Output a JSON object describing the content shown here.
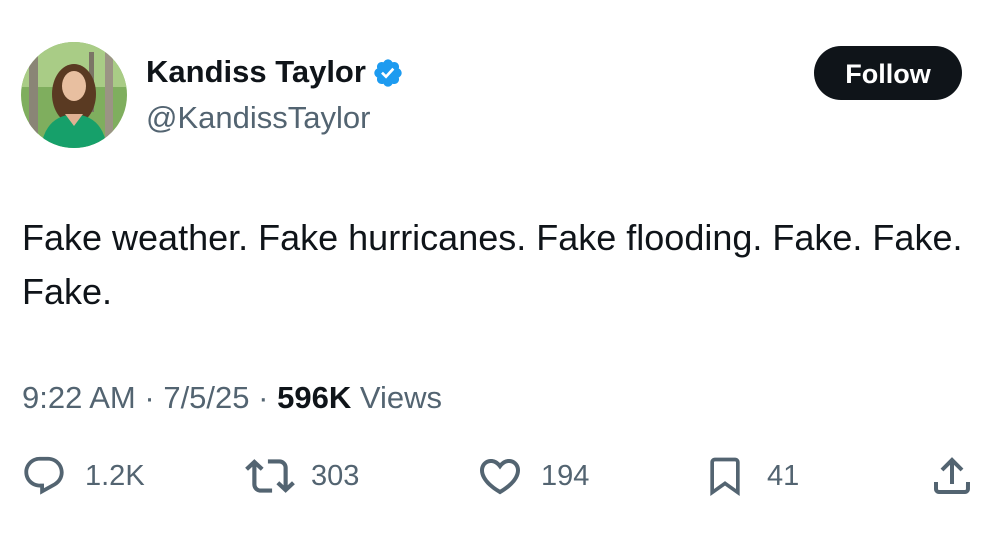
{
  "profile": {
    "display_name": "Kandiss Taylor",
    "handle": "@KandissTaylor",
    "verified": true
  },
  "follow_button": {
    "label": "Follow"
  },
  "tweet": {
    "text": "Fake weather. Fake hurricanes. Fake flooding. Fake. Fake. Fake."
  },
  "meta": {
    "time": "9:22 AM",
    "separator": "·",
    "date": "7/5/25",
    "views_count": "596K",
    "views_label": "Views"
  },
  "actions": {
    "replies": {
      "icon": "reply-icon",
      "count": "1.2K"
    },
    "reposts": {
      "icon": "repost-icon",
      "count": "303"
    },
    "likes": {
      "icon": "heart-icon",
      "count": "194"
    },
    "bookmarks": {
      "icon": "bookmark-icon",
      "count": "41"
    },
    "share": {
      "icon": "share-icon"
    }
  },
  "colors": {
    "text_primary": "#0f1419",
    "text_secondary": "#536471",
    "verified_badge": "#1d9bf0",
    "button_bg": "#0f1419",
    "button_text": "#ffffff"
  }
}
